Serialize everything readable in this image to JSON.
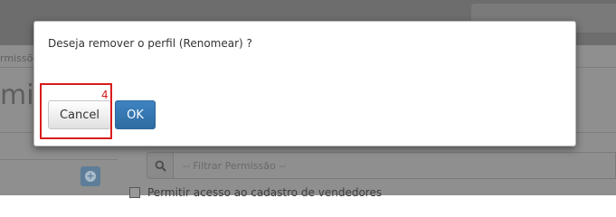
{
  "background": {
    "breadcrumb": "rmissões",
    "page_title": "miss",
    "filter_placeholder": "-- Filtrar Permissão --",
    "permission_label": "Permitir acesso ao cadastro de vendedores",
    "search_icon": "search-icon",
    "add_icon": "plus-circle-icon"
  },
  "dialog": {
    "message": "Deseja remover o perfil (Renomear) ?",
    "cancel_label": "Cancel",
    "ok_label": "OK"
  },
  "annotation": {
    "step_number": "4",
    "color": "#d81c1c"
  }
}
